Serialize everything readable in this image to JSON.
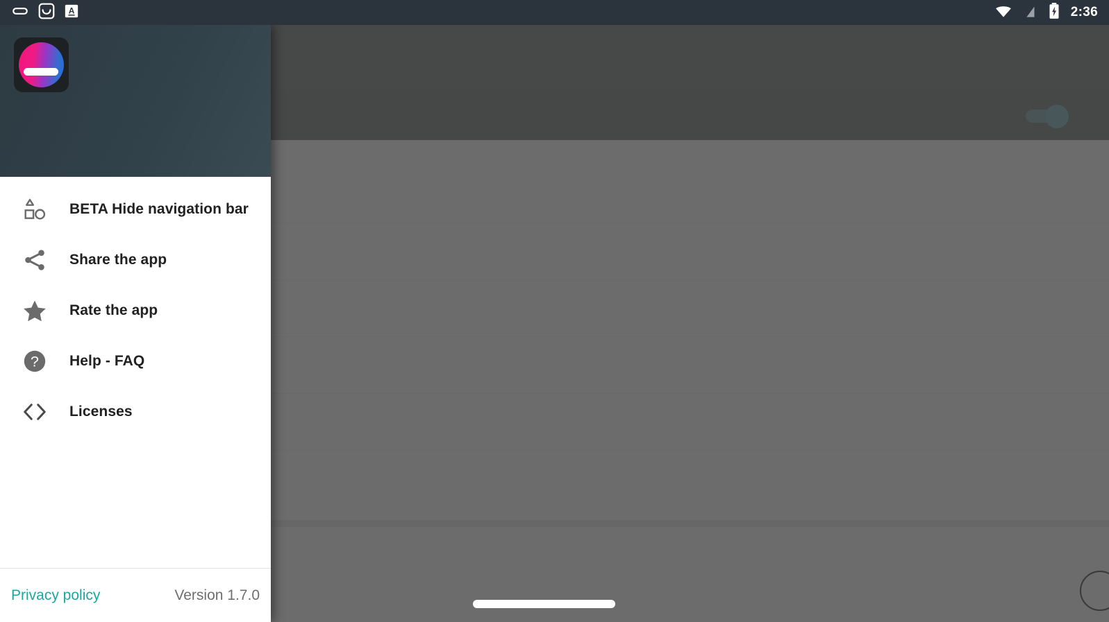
{
  "status_bar": {
    "icons_left": [
      "capsule-notification-icon",
      "inbox-notification-icon",
      "font-size-notification-icon"
    ],
    "icons_right": [
      "wifi-icon",
      "cellular-signal-off-icon",
      "battery-charging-icon"
    ],
    "clock": "2:36",
    "background_color": "#2b343c",
    "text_color": "#ffffff"
  },
  "drawer": {
    "header": {
      "logo_icon": "app-logo-icon",
      "background_color": "#31414a"
    },
    "items": [
      {
        "icon": "navigation-bar-icon",
        "label": "BETA Hide navigation bar"
      },
      {
        "icon": "share-icon",
        "label": "Share the app"
      },
      {
        "icon": "star-icon",
        "label": "Rate the app"
      },
      {
        "icon": "help-circle-icon",
        "label": "Help - FAQ"
      },
      {
        "icon": "code-brackets-icon",
        "label": "Licenses"
      }
    ],
    "footer": {
      "privacy_policy_label": "Privacy policy",
      "privacy_policy_color": "#1aa8a0",
      "version_label": "Version 1.7.0"
    }
  },
  "content": {
    "toolbar_color": "#1a1e21",
    "toggle": {
      "name": "master-toggle",
      "state": "on",
      "accent_color": "#1e7f8c"
    },
    "list_rows": 5,
    "fab_icon": "floating-action-button",
    "home_indicator": "gesture-home-indicator",
    "scrim_color": "rgba(0,0,0,0.4)"
  }
}
